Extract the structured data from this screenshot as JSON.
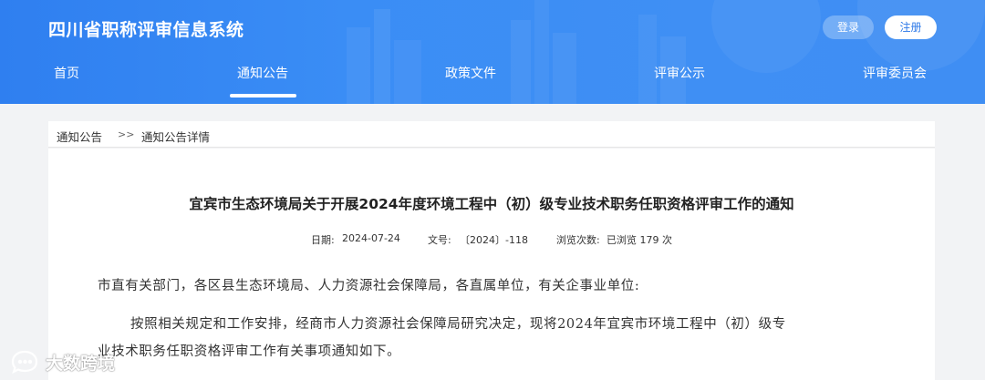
{
  "header": {
    "site_title": "四川省职称评审信息系统",
    "login_label": "登录",
    "register_label": "注册",
    "nav": [
      {
        "label": "首页"
      },
      {
        "label": "通知公告",
        "active": true
      },
      {
        "label": "政策文件"
      },
      {
        "label": "评审公示"
      },
      {
        "label": "评审委员会"
      }
    ]
  },
  "breadcrumb": {
    "parent": "通知公告",
    "separator": ">>",
    "current": "通知公告详情"
  },
  "article": {
    "title": "宜宾市生态环境局关于开展2024年度环境工程中（初）级专业技术职务任职资格评审工作的通知",
    "date_label": "日期:",
    "date": "2024-07-24",
    "docno_label": "文号:",
    "docno": "〔2024〕-118",
    "views_label": "浏览次数:",
    "views": "已浏览 179 次",
    "salutation": "市直有关部门，各区县生态环境局、人力资源社会保障局，各直属单位，有关企事业单位:",
    "paragraph_line1": "按照相关规定和工作安排，经商市人力资源社会保障局研究决定，现将2024年宜宾市环境工程中（初）级专",
    "paragraph_line2": "业技术职务任职资格评审工作有关事项通知如下。"
  },
  "watermark": {
    "text": "大数跨境",
    "icon": "chat-bubble-logo-icon"
  },
  "colors": {
    "header_blue": "#3a8af4",
    "page_bg": "#f2f3f5",
    "register_text": "#2d79e8"
  }
}
